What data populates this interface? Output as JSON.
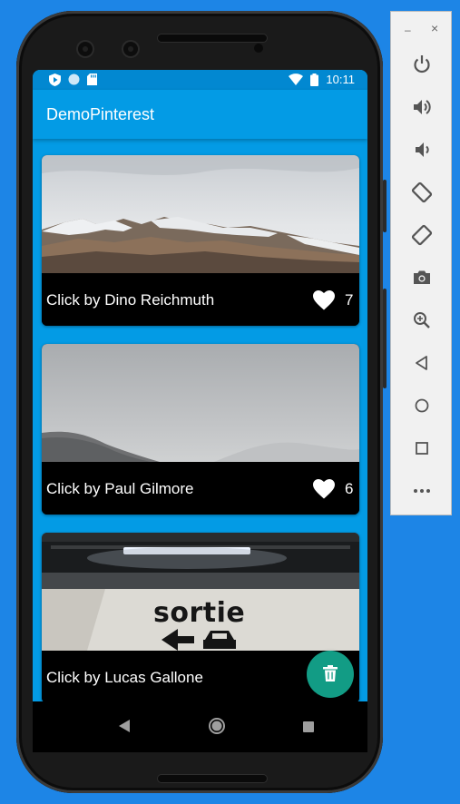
{
  "app": {
    "title": "DemoPinterest"
  },
  "status_bar": {
    "time": "10:11",
    "left_icons": [
      "play-shield-icon",
      "circle-icon",
      "sd-card-icon"
    ],
    "right_icons": [
      "wifi-icon",
      "battery-icon"
    ]
  },
  "cards": [
    {
      "caption": "Click by Dino Reichmuth",
      "likes": "7",
      "photo": "snowy-mountains-image"
    },
    {
      "caption": "Click by Paul Gilmore",
      "likes": "6",
      "photo": "foggy-hills-image"
    },
    {
      "caption": "Click by Lucas Gallone",
      "likes": "",
      "photo": "sortie-sign-image",
      "photo_text": "sortie"
    }
  ],
  "fab": {
    "icon": "trash-icon"
  },
  "nav": {
    "icons": [
      "back-icon",
      "home-icon",
      "recents-icon"
    ]
  },
  "emulator_toolbar": {
    "window": {
      "minimize": "–",
      "close": "×"
    },
    "buttons": [
      "power-icon",
      "volume-up-icon",
      "volume-down-icon",
      "rotate-left-icon",
      "rotate-right-icon",
      "camera-icon",
      "zoom-icon",
      "back-icon",
      "home-icon",
      "overview-icon",
      "more-icon"
    ]
  },
  "colors": {
    "background": "#1d85e6",
    "app_bar": "#039be5",
    "status_bar": "#0288d1",
    "fab": "#129c85",
    "caption_bar": "#000000"
  }
}
